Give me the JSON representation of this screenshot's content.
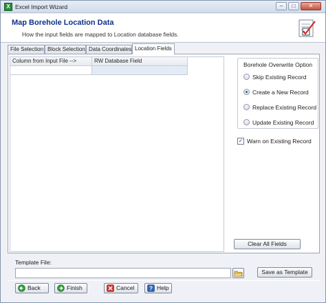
{
  "window": {
    "title": "Excel Import Wizard"
  },
  "header": {
    "title": "Map Borehole Location Data",
    "subtitle": "How the input fields are mapped to Location database fields."
  },
  "tabs": [
    {
      "label": "File Selection",
      "active": false
    },
    {
      "label": "Block Selection",
      "active": false
    },
    {
      "label": "Data Coordinates",
      "active": false
    },
    {
      "label": "Location Fields",
      "active": true
    }
  ],
  "grid": {
    "columns": [
      "Column from Input File  -->",
      "RW Database Field"
    ],
    "rows": [
      [
        "",
        ""
      ]
    ]
  },
  "overwrite": {
    "label": "Borehole Overwrite Option",
    "options": [
      {
        "label": "Skip Existing Record",
        "checked": false
      },
      {
        "label": "Create a New Record",
        "checked": true
      },
      {
        "label": "Replace Existing Record",
        "checked": false
      },
      {
        "label": "Update Existing Record",
        "checked": false
      }
    ]
  },
  "warn": {
    "label": "Warn on Existing Record",
    "checked": true
  },
  "clear_label": "Clear All Fields",
  "template": {
    "label": "Template File:",
    "value": "",
    "save_label": "Save as Template"
  },
  "footer": {
    "back": "Back",
    "finish": "Finish",
    "cancel": "Cancel",
    "help": "Help"
  },
  "colors": {
    "header_title": "#10308a",
    "selected_cell": "#e3ebf7",
    "finish_icon": "#2e9a3a",
    "cancel_icon": "#c8352c",
    "help_icon": "#2f63b5"
  }
}
